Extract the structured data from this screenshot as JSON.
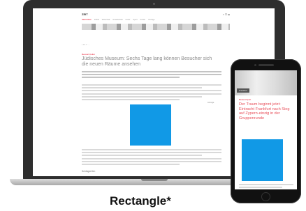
{
  "caption": "Rectangle*",
  "laptop": {
    "site": {
      "logo": "ZEIT",
      "header_icons": "⌕ ✉ ☰",
      "nav": [
        "Nachrichten",
        "Politik",
        "Wirtschaft",
        "Gesellschaft",
        "Kultur",
        "Sport",
        "Kinder",
        "Anzeige"
      ],
      "meta": "▪ ✉ ↗ ···",
      "category": "Ressort Kultur",
      "title": "Jüdisches Museum: Sechs Tage lang können Besucher sich die neuen Räume ansehen",
      "aside_label": "Anzeige",
      "subhead": "Schlagzeilen",
      "ad_color": "#1199e6"
    }
  },
  "phone": {
    "hero_tag": "Frankfurt",
    "category": "Ressort Sport",
    "title": "Der Traum beginnt jetzt: Eintracht Frankfurt nach Sieg auf Zypern-einzig in der Gruppenrunde",
    "ad_color": "#1199e6"
  },
  "colors": {
    "accent": "#e2001a",
    "ad_blue": "#1199e6"
  }
}
